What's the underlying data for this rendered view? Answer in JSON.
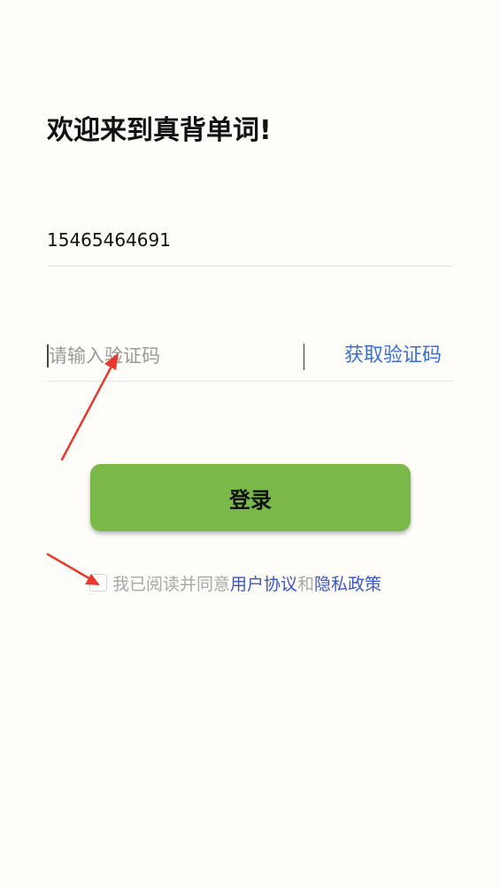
{
  "header": {
    "title": "欢迎来到真背单词!"
  },
  "form": {
    "phone_value": "15465464691",
    "code_placeholder": "请输入验证码",
    "get_code_label": "获取验证码",
    "login_label": "登录"
  },
  "agreement": {
    "prefix": "我已阅读并同意",
    "user_agreement": "用户协议",
    "and": "和",
    "privacy_policy": "隐私政策",
    "checked": false
  },
  "colors": {
    "background": "#fefdf9",
    "login_button": "#7ab84a",
    "link": "#3a6fd6",
    "annotation_arrow": "#e8392c"
  }
}
